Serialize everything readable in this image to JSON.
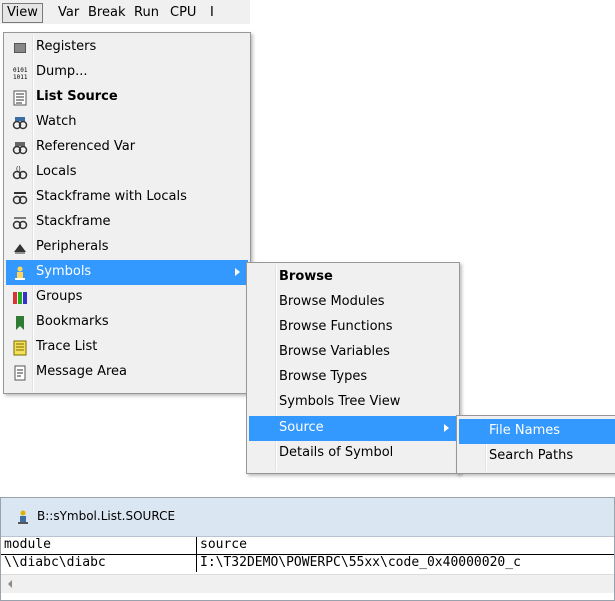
{
  "menubar": {
    "items": [
      "View",
      "Var",
      "Break",
      "Run",
      "CPU",
      "I"
    ]
  },
  "view_menu": {
    "items": [
      {
        "label": "Registers",
        "icon": "registers-icon"
      },
      {
        "label": "Dump...",
        "icon": "dump-icon"
      },
      {
        "label": "List Source",
        "icon": "list-source-icon",
        "bold": true
      },
      {
        "label": "Watch",
        "icon": "watch-icon"
      },
      {
        "label": "Referenced Var",
        "icon": "referenced-var-icon"
      },
      {
        "label": "Locals",
        "icon": "locals-icon"
      },
      {
        "label": "Stackframe with Locals",
        "icon": "stackframe-locals-icon"
      },
      {
        "label": "Stackframe",
        "icon": "stackframe-icon"
      },
      {
        "label": "Peripherals",
        "icon": "peripherals-icon"
      },
      {
        "label": "Symbols",
        "icon": "symbols-icon",
        "highlighted": true,
        "submenu": true
      },
      {
        "label": "Groups",
        "icon": "groups-icon"
      },
      {
        "label": "Bookmarks",
        "icon": "bookmarks-icon"
      },
      {
        "label": "Trace List",
        "icon": "trace-list-icon"
      },
      {
        "label": "Message Area",
        "icon": "message-area-icon"
      }
    ]
  },
  "symbols_menu": {
    "items": [
      {
        "label": "Browse",
        "bold": true
      },
      {
        "label": "Browse Modules"
      },
      {
        "label": "Browse Functions"
      },
      {
        "label": "Browse Variables"
      },
      {
        "label": "Browse Types"
      },
      {
        "label": "Symbols Tree View"
      },
      {
        "label": "Source",
        "highlighted": true,
        "submenu": true
      },
      {
        "label": "Details of Symbol"
      }
    ]
  },
  "source_menu": {
    "items": [
      {
        "label": "File Names",
        "highlighted": true
      },
      {
        "label": "Search Paths"
      }
    ]
  },
  "window": {
    "title": "B::sYmbol.List.SOURCE",
    "columns": [
      "module",
      "source"
    ],
    "rows": [
      [
        "\\\\diabc\\diabc",
        "I:\\T32DEMO\\POWERPC\\55xx\\code_0x40000020_c"
      ]
    ]
  },
  "colors": {
    "highlight": "#3399ff",
    "menu_bg": "#f0f0f0"
  }
}
